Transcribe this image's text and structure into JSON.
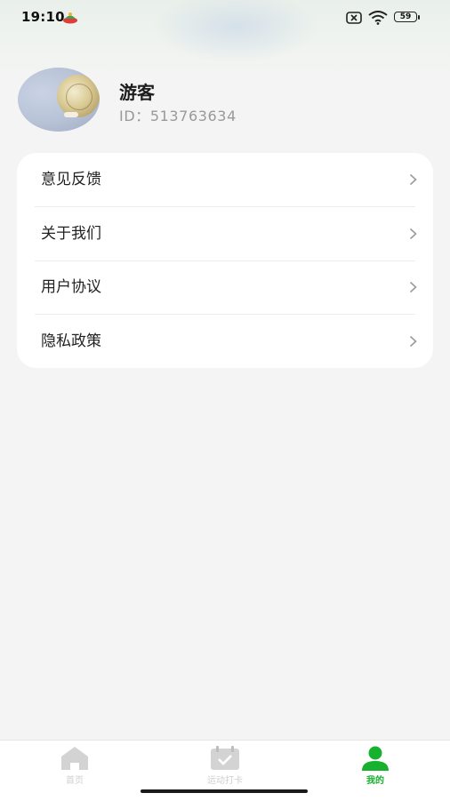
{
  "status_bar": {
    "time": "19:10",
    "battery": "59"
  },
  "profile": {
    "nickname": "游客",
    "id_text": "ID：513763634"
  },
  "menu": {
    "items": [
      {
        "label": "意见反馈"
      },
      {
        "label": "关于我们"
      },
      {
        "label": "用户协议"
      },
      {
        "label": "隐私政策"
      }
    ]
  },
  "tabs": [
    {
      "label": "首页",
      "icon": "home-icon",
      "active": false
    },
    {
      "label": "运动打卡",
      "icon": "calendar-check-icon",
      "active": false
    },
    {
      "label": "我的",
      "icon": "user-icon",
      "active": true
    }
  ],
  "colors": {
    "accent": "#16b12f",
    "background": "#f4f4f4",
    "card": "#ffffff",
    "inactive_tab": "#cfcfcf"
  }
}
